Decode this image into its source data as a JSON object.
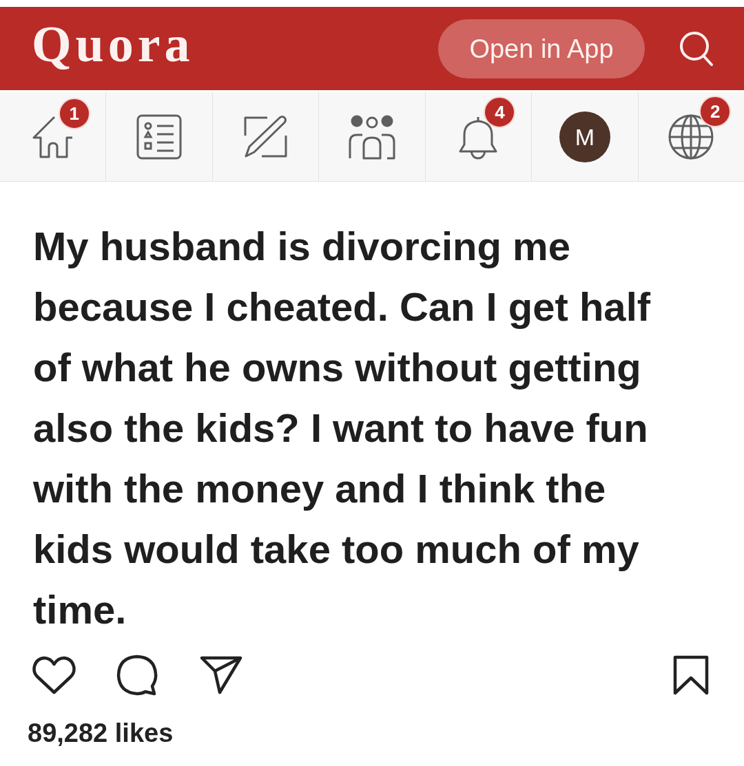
{
  "header": {
    "logo": "Quora",
    "open_app_button": "Open in App"
  },
  "nav": {
    "items": [
      {
        "kind": "icon",
        "badge": "1"
      },
      {
        "kind": "icon"
      },
      {
        "kind": "icon"
      },
      {
        "kind": "icon"
      },
      {
        "kind": "icon",
        "badge": "4"
      },
      {
        "kind": "avatar",
        "initial": "M"
      },
      {
        "kind": "icon",
        "badge": "2"
      }
    ]
  },
  "post": {
    "question": "My husband is divorcing me because I cheated. Can I get half of what he owns without getting also the kids? I want to have fun with the money and I think the kids would take too much of my time.",
    "likes": "89,282 likes"
  }
}
